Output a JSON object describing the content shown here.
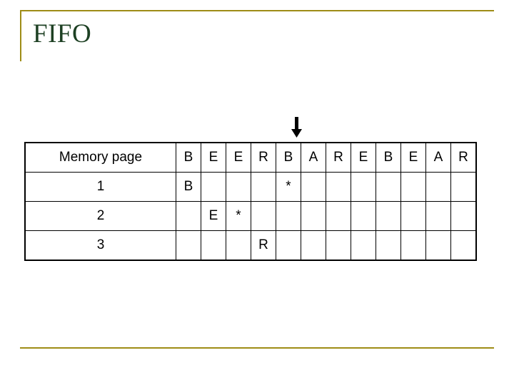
{
  "slide": {
    "title": "FIFO",
    "accent_color": "#9e8c16",
    "title_color": "#1d4023",
    "highlight_color": "#c2185b"
  },
  "arrow": {
    "name": "down-arrow",
    "points_to_column_index": 4
  },
  "table": {
    "header_label": "Memory page",
    "reference_string": [
      "B",
      "E",
      "E",
      "R",
      "B",
      "A",
      "R",
      "E",
      "B",
      "E",
      "A",
      "R"
    ],
    "rows": [
      {
        "label": "1",
        "cells": [
          "B",
          "",
          "",
          "",
          "*",
          "",
          "",
          "",
          "",
          "",
          "",
          ""
        ]
      },
      {
        "label": "2",
        "cells": [
          "",
          "E",
          "*",
          "",
          "",
          "",
          "",
          "",
          "",
          "",
          "",
          ""
        ]
      },
      {
        "label": "3",
        "cells": [
          "",
          "",
          "",
          "R",
          "",
          "",
          "",
          "",
          "",
          "",
          "",
          ""
        ]
      }
    ]
  }
}
